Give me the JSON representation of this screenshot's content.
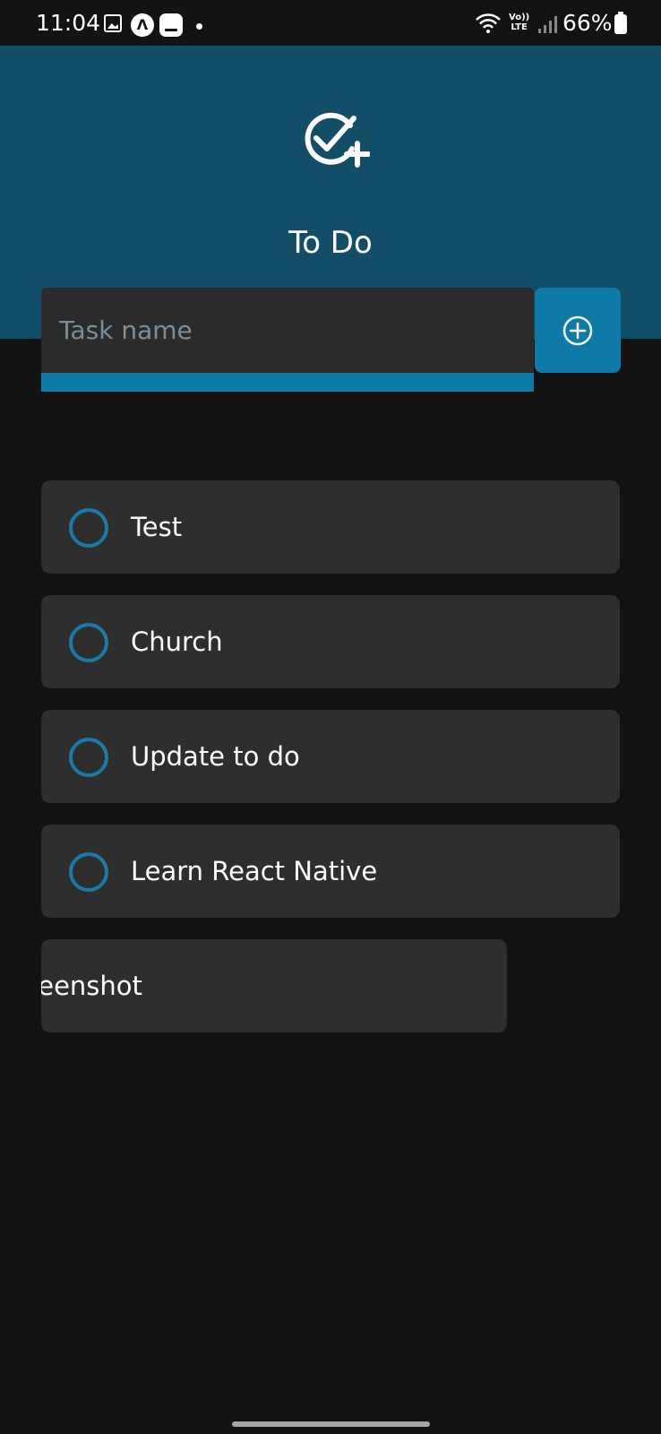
{
  "status_bar": {
    "time": "11:04",
    "network_label_top": "Vo))",
    "network_label_bottom": "LTE",
    "battery": "66%",
    "icons": [
      "gallery-icon",
      "expo-icon",
      "keyboard-icon",
      "notification-dot-icon",
      "wifi-icon",
      "signal-icon",
      "battery-icon"
    ]
  },
  "header": {
    "title": "To Do",
    "logo_icon": "check-circle-plus-icon",
    "background_color": "#124e68"
  },
  "new_task": {
    "placeholder": "Task name",
    "value": "",
    "add_button_icon": "plus-circle-icon",
    "accent_color": "#0e7aa8"
  },
  "tasks": [
    {
      "label": "Test",
      "done": false
    },
    {
      "label": "Church",
      "done": false
    },
    {
      "label": "Update to do",
      "done": false
    },
    {
      "label": "Learn React Native",
      "done": false
    },
    {
      "label": "creenshot",
      "done": false
    }
  ]
}
